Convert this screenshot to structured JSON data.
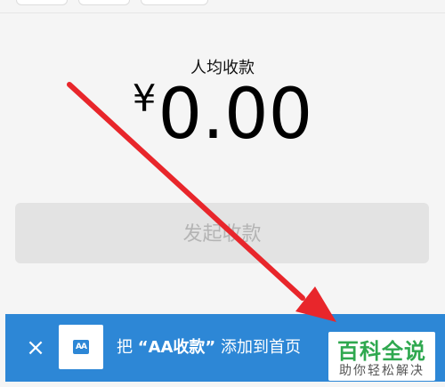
{
  "summary": {
    "per_person_label": "人均收款",
    "currency_symbol": "¥",
    "amount": "0.00"
  },
  "actions": {
    "initiate_collection_label": "发起收款"
  },
  "banner": {
    "close_glyph": "×",
    "app_icon_label": "AA",
    "text_prefix": "把 ",
    "app_name": "“AA收款”",
    "text_suffix": " 添加到首页",
    "background_color": "#2d87d6"
  },
  "watermark": {
    "title": "百科全说",
    "subtitle": "助你轻松解决",
    "title_color": "#2fa84f"
  },
  "annotation": {
    "arrow_color": "#e8262b"
  }
}
